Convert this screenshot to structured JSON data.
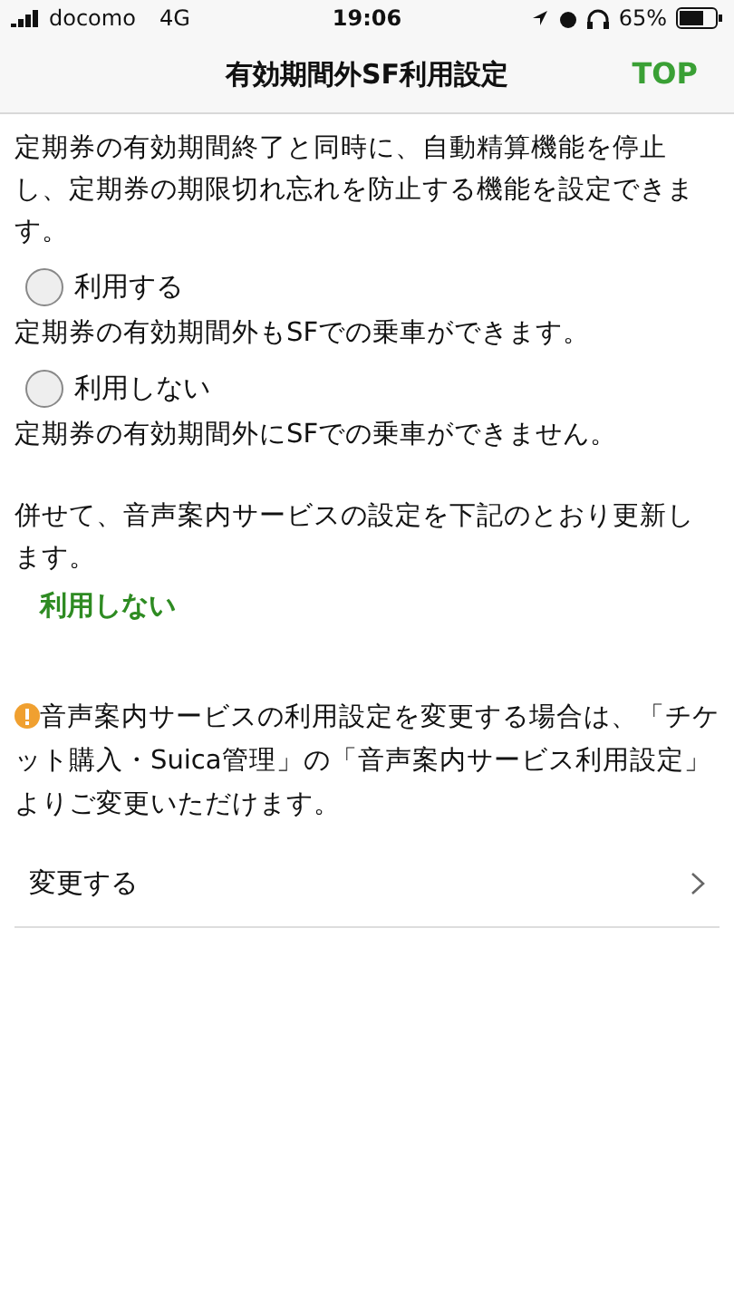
{
  "status_bar": {
    "carrier": "docomo",
    "network": "4G",
    "time": "19:06",
    "battery": "65%"
  },
  "nav": {
    "title": "有効期間外SF利用設定",
    "action": "TOP"
  },
  "intro": "定期券の有効期間終了と同時に、自動精算機能を停止し、定期券の期限切れ忘れを防止する機能を設定できます。",
  "options": [
    {
      "label": "利用する",
      "selected": false,
      "description": "定期券の有効期間外もSFでの乗車ができます。"
    },
    {
      "label": "利用しない",
      "selected": false,
      "description": "定期券の有効期間外にSFでの乗車ができません。"
    }
  ],
  "voice_notice": "併せて、音声案内サービスの設定を下記のとおり更新します。",
  "voice_value": "利用しない",
  "warning": "音声案内サービスの利用設定を変更する場合は、「チケット購入・Suica管理」の「音声案内サービス利用設定」よりご変更いただけます。",
  "change_link": "変更する"
}
